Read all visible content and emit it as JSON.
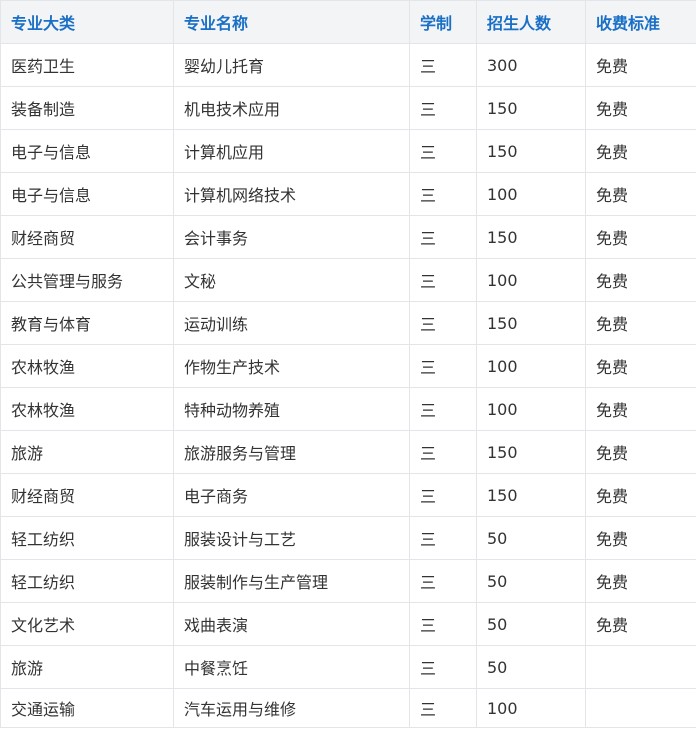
{
  "table": {
    "headers": [
      "专业大类",
      "专业名称",
      "学制",
      "招生人数",
      "收费标准"
    ],
    "rows": [
      [
        "医药卫生",
        "婴幼儿托育",
        "三",
        "300",
        "免费"
      ],
      [
        "装备制造",
        "机电技术应用",
        "三",
        "150",
        "免费"
      ],
      [
        "电子与信息",
        "计算机应用",
        "三",
        "150",
        "免费"
      ],
      [
        "电子与信息",
        "计算机网络技术",
        "三",
        "100",
        "免费"
      ],
      [
        "财经商贸",
        "会计事务",
        "三",
        "150",
        "免费"
      ],
      [
        "公共管理与服务",
        "文秘",
        "三",
        "100",
        "免费"
      ],
      [
        "教育与体育",
        "运动训练",
        "三",
        "150",
        "免费"
      ],
      [
        "农林牧渔",
        "作物生产技术",
        "三",
        "100",
        "免费"
      ],
      [
        "农林牧渔",
        "特种动物养殖",
        "三",
        "100",
        "免费"
      ],
      [
        "旅游",
        "旅游服务与管理",
        "三",
        "150",
        "免费"
      ],
      [
        "财经商贸",
        "电子商务",
        "三",
        "150",
        "免费"
      ],
      [
        "轻工纺织",
        "服装设计与工艺",
        "三",
        "50",
        "免费"
      ],
      [
        "轻工纺织",
        "服装制作与生产管理",
        "三",
        "50",
        "免费"
      ],
      [
        "文化艺术",
        "戏曲表演",
        "三",
        "50",
        "免费"
      ],
      [
        "旅游",
        "中餐烹饪",
        "三",
        "50",
        ""
      ],
      [
        "交通运输",
        "汽车运用与维修",
        "三",
        "100",
        ""
      ]
    ]
  },
  "colors": {
    "header_text": "#1a6fc6",
    "header_bg": "#f2f4f6",
    "border": "#e2e6ea",
    "body_text": "#333333"
  }
}
